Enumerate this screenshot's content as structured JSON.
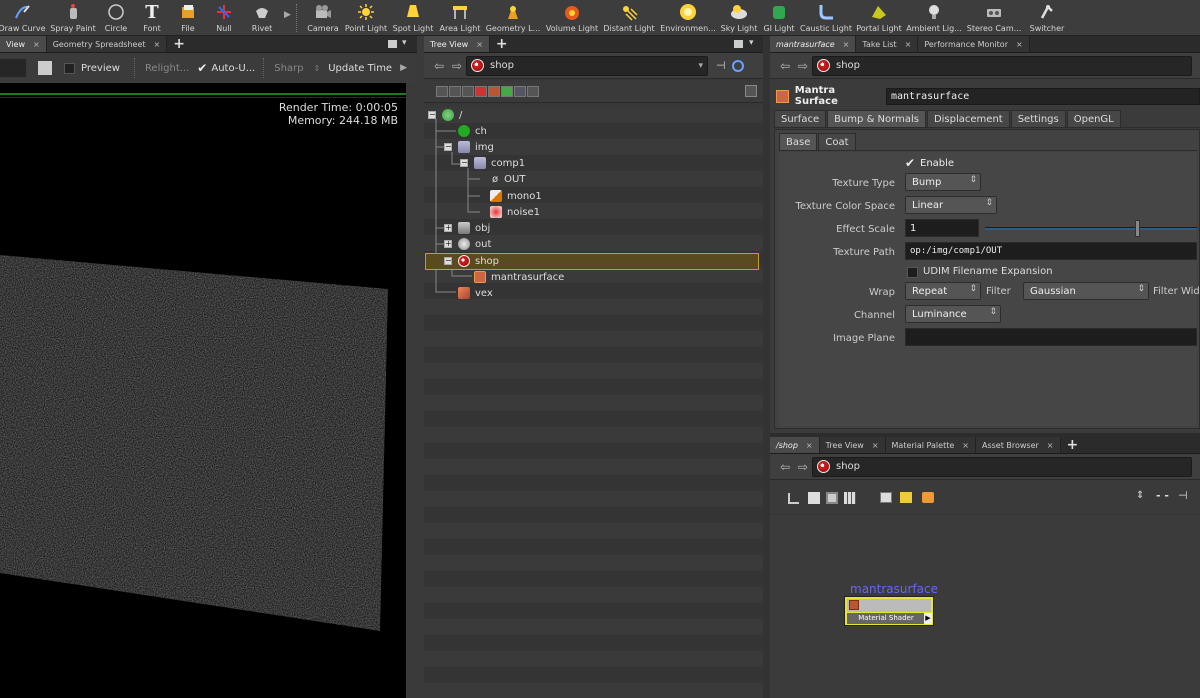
{
  "shelf": {
    "tools": [
      {
        "label": "Draw Curve",
        "icon": "draw-curve-icon"
      },
      {
        "label": "Spray Paint",
        "icon": "spray-paint-icon"
      },
      {
        "label": "Circle",
        "icon": "circle-icon"
      },
      {
        "label": "Font",
        "icon": "font-icon"
      },
      {
        "label": "File",
        "icon": "file-icon"
      },
      {
        "label": "Null",
        "icon": "null-icon"
      },
      {
        "label": "Rivet",
        "icon": "rivet-icon"
      },
      {
        "label": "Camera",
        "icon": "camera-icon"
      },
      {
        "label": "Point Light",
        "icon": "point-light-icon"
      },
      {
        "label": "Spot Light",
        "icon": "spot-light-icon"
      },
      {
        "label": "Area Light",
        "icon": "area-light-icon"
      },
      {
        "label": "Geometry L...",
        "icon": "geometry-light-icon"
      },
      {
        "label": "Volume Light",
        "icon": "volume-light-icon"
      },
      {
        "label": "Distant Light",
        "icon": "distant-light-icon"
      },
      {
        "label": "Environmen...",
        "icon": "environment-light-icon"
      },
      {
        "label": "Sky Light",
        "icon": "sky-light-icon"
      },
      {
        "label": "GI Light",
        "icon": "gi-light-icon"
      },
      {
        "label": "Caustic Light",
        "icon": "caustic-light-icon"
      },
      {
        "label": "Portal Light",
        "icon": "portal-light-icon"
      },
      {
        "label": "Ambient Lig...",
        "icon": "ambient-light-icon"
      },
      {
        "label": "Stereo Cam...",
        "icon": "stereo-camera-icon"
      },
      {
        "label": "Switcher",
        "icon": "switcher-icon"
      }
    ]
  },
  "viewport": {
    "tabs": [
      {
        "label": "View"
      },
      {
        "label": "Geometry Spreadsheet"
      }
    ],
    "toolbar": {
      "preview": "Preview",
      "relight": "Relight...",
      "auto_update": "Auto-U...",
      "sharp": "Sharp",
      "update_time": "Update Time"
    },
    "render_time": "Render Time: 0:00:05",
    "memory": "Memory:   244.18 MB"
  },
  "tree": {
    "tab": "Tree View",
    "path": "shop",
    "nodes": [
      {
        "label": "/"
      },
      {
        "label": "ch"
      },
      {
        "label": "img"
      },
      {
        "label": "comp1"
      },
      {
        "label": "OUT"
      },
      {
        "label": "mono1"
      },
      {
        "label": "noise1"
      },
      {
        "label": "obj"
      },
      {
        "label": "out"
      },
      {
        "label": "shop"
      },
      {
        "label": "mantrasurface"
      },
      {
        "label": "vex"
      }
    ]
  },
  "params": {
    "tabs": [
      {
        "label": "mantrasurface"
      },
      {
        "label": "Take List"
      },
      {
        "label": "Performance Monitor"
      }
    ],
    "path": "shop",
    "node_type": "Mantra Surface",
    "node_name": "mantrasurface",
    "main_tabs": [
      {
        "label": "Surface"
      },
      {
        "label": "Bump & Normals"
      },
      {
        "label": "Displacement"
      },
      {
        "label": "Settings"
      },
      {
        "label": "OpenGL"
      }
    ],
    "sub_tabs": [
      {
        "label": "Base"
      },
      {
        "label": "Coat"
      }
    ],
    "enable": "Enable",
    "texture_type_label": "Texture Type",
    "texture_type": "Bump",
    "color_space_label": "Texture Color Space",
    "color_space": "Linear",
    "effect_scale_label": "Effect Scale",
    "effect_scale": "1",
    "texture_path_label": "Texture Path",
    "texture_path": "op:/img/comp1/OUT",
    "udim": "UDIM Filename Expansion",
    "wrap_label": "Wrap",
    "wrap": "Repeat",
    "filter_label": "Filter",
    "filter": "Gaussian",
    "filter_width_label": "Filter Widt",
    "channel_label": "Channel",
    "channel": "Luminance",
    "image_plane_label": "Image Plane"
  },
  "network": {
    "tabs": [
      {
        "label": "/shop"
      },
      {
        "label": "Tree View"
      },
      {
        "label": "Material Palette"
      },
      {
        "label": "Asset Browser"
      }
    ],
    "path": "shop",
    "node_name": "mantrasurface",
    "node_label": "Material Shader"
  }
}
